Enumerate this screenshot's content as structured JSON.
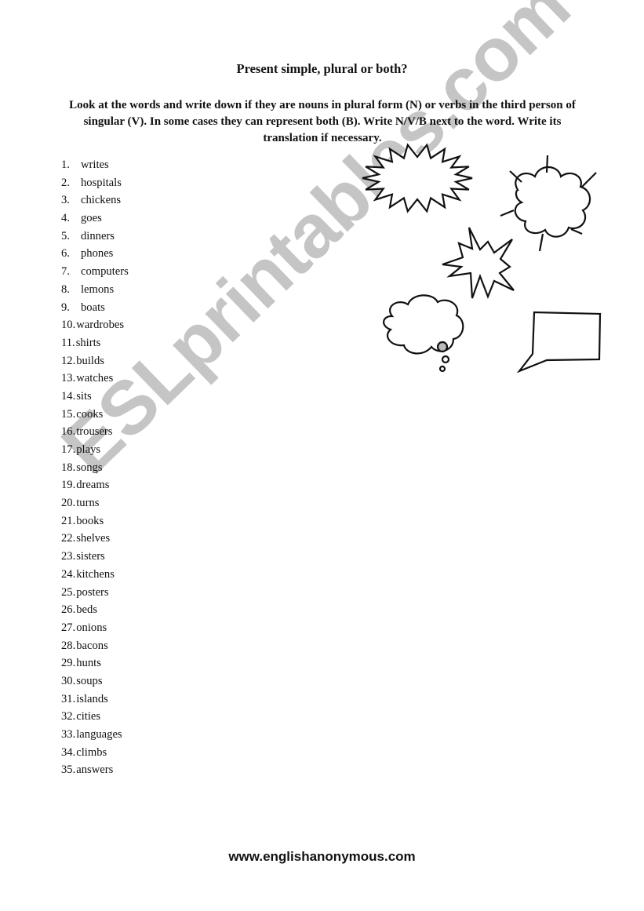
{
  "title": "Present simple, plural or both?",
  "instructions": "Look at the words and write down if they are nouns in plural form (N) or verbs in the third person of singular (V). In some cases they can represent both (B). Write N/V/B next to the word. Write its translation if necessary.",
  "words": [
    {
      "num": "1.",
      "word": "writes"
    },
    {
      "num": "2.",
      "word": "hospitals"
    },
    {
      "num": "3.",
      "word": "chickens"
    },
    {
      "num": "4.",
      "word": "goes"
    },
    {
      "num": "5.",
      "word": "dinners"
    },
    {
      "num": "6.",
      "word": "phones"
    },
    {
      "num": "7.",
      "word": "computers"
    },
    {
      "num": "8.",
      "word": "lemons"
    },
    {
      "num": "9.",
      "word": "boats"
    },
    {
      "num": "10.",
      "word": "wardrobes"
    },
    {
      "num": "11.",
      "word": "shirts"
    },
    {
      "num": "12.",
      "word": "builds"
    },
    {
      "num": "13.",
      "word": "watches"
    },
    {
      "num": "14.",
      "word": "sits"
    },
    {
      "num": "15.",
      "word": "cooks"
    },
    {
      "num": "16.",
      "word": "trousers"
    },
    {
      "num": "17.",
      "word": "plays"
    },
    {
      "num": "18.",
      "word": "songs"
    },
    {
      "num": "19.",
      "word": "dreams"
    },
    {
      "num": "20.",
      "word": "turns"
    },
    {
      "num": "21.",
      "word": "books"
    },
    {
      "num": "22.",
      "word": "shelves"
    },
    {
      "num": "23.",
      "word": "sisters"
    },
    {
      "num": "24.",
      "word": "kitchens"
    },
    {
      "num": "25.",
      "word": "posters"
    },
    {
      "num": "26.",
      "word": "beds"
    },
    {
      "num": "27.",
      "word": "onions"
    },
    {
      "num": "28.",
      "word": "bacons"
    },
    {
      "num": "29.",
      "word": "hunts"
    },
    {
      "num": "30.",
      "word": "soups"
    },
    {
      "num": "31.",
      "word": "islands"
    },
    {
      "num": "32.",
      "word": "cities"
    },
    {
      "num": "33.",
      "word": "languages"
    },
    {
      "num": "34.",
      "word": "climbs"
    },
    {
      "num": "35.",
      "word": "answers"
    }
  ],
  "illustrations": [
    "spiky-oval-bubble",
    "explosion-cloud-bubble",
    "star-burst-bubble",
    "thought-cloud-bubble",
    "rectangular-speech-bubble"
  ],
  "watermark": "ESLprintables.com",
  "footer": "www.englishanonymous.com"
}
